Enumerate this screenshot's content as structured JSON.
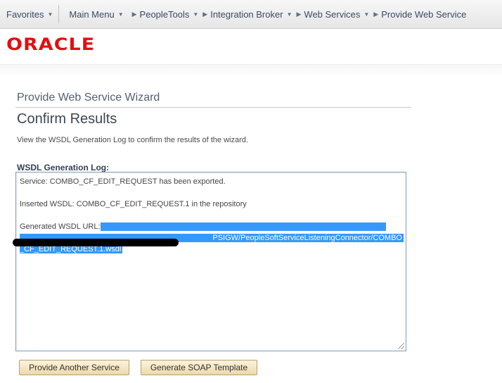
{
  "nav": {
    "favorites": "Favorites",
    "main_menu": "Main Menu",
    "breadcrumbs": [
      "PeopleTools",
      "Integration Broker",
      "Web Services",
      "Provide Web Service"
    ]
  },
  "brand": {
    "logo": "ORACLE"
  },
  "wizard": {
    "title": "Provide Web Service Wizard",
    "heading": "Confirm Results",
    "instructions": "View the WSDL Generation Log to confirm the results of the wizard."
  },
  "log": {
    "label": "WSDL Generation Log:",
    "service_line": "Service: COMBO_CF_EDIT_REQUEST has been exported.",
    "inserted_line": "Inserted WSDL: COMBO_CF_EDIT_REQUEST.1 in the repository",
    "generated_label": "Generated WSDL URL:",
    "url_part1": "PSIGW/PeopleSoftServiceListeningConnector/COMBO",
    "url_part2": "_CF_EDIT_REQUEST.1.wsdl"
  },
  "buttons": {
    "provide_another": "Provide Another Service",
    "generate_soap": "Generate SOAP Template"
  },
  "colors": {
    "oracle_red": "#e30f0f",
    "selection": "#3399ff",
    "button_fill": "#f3e3bd"
  }
}
